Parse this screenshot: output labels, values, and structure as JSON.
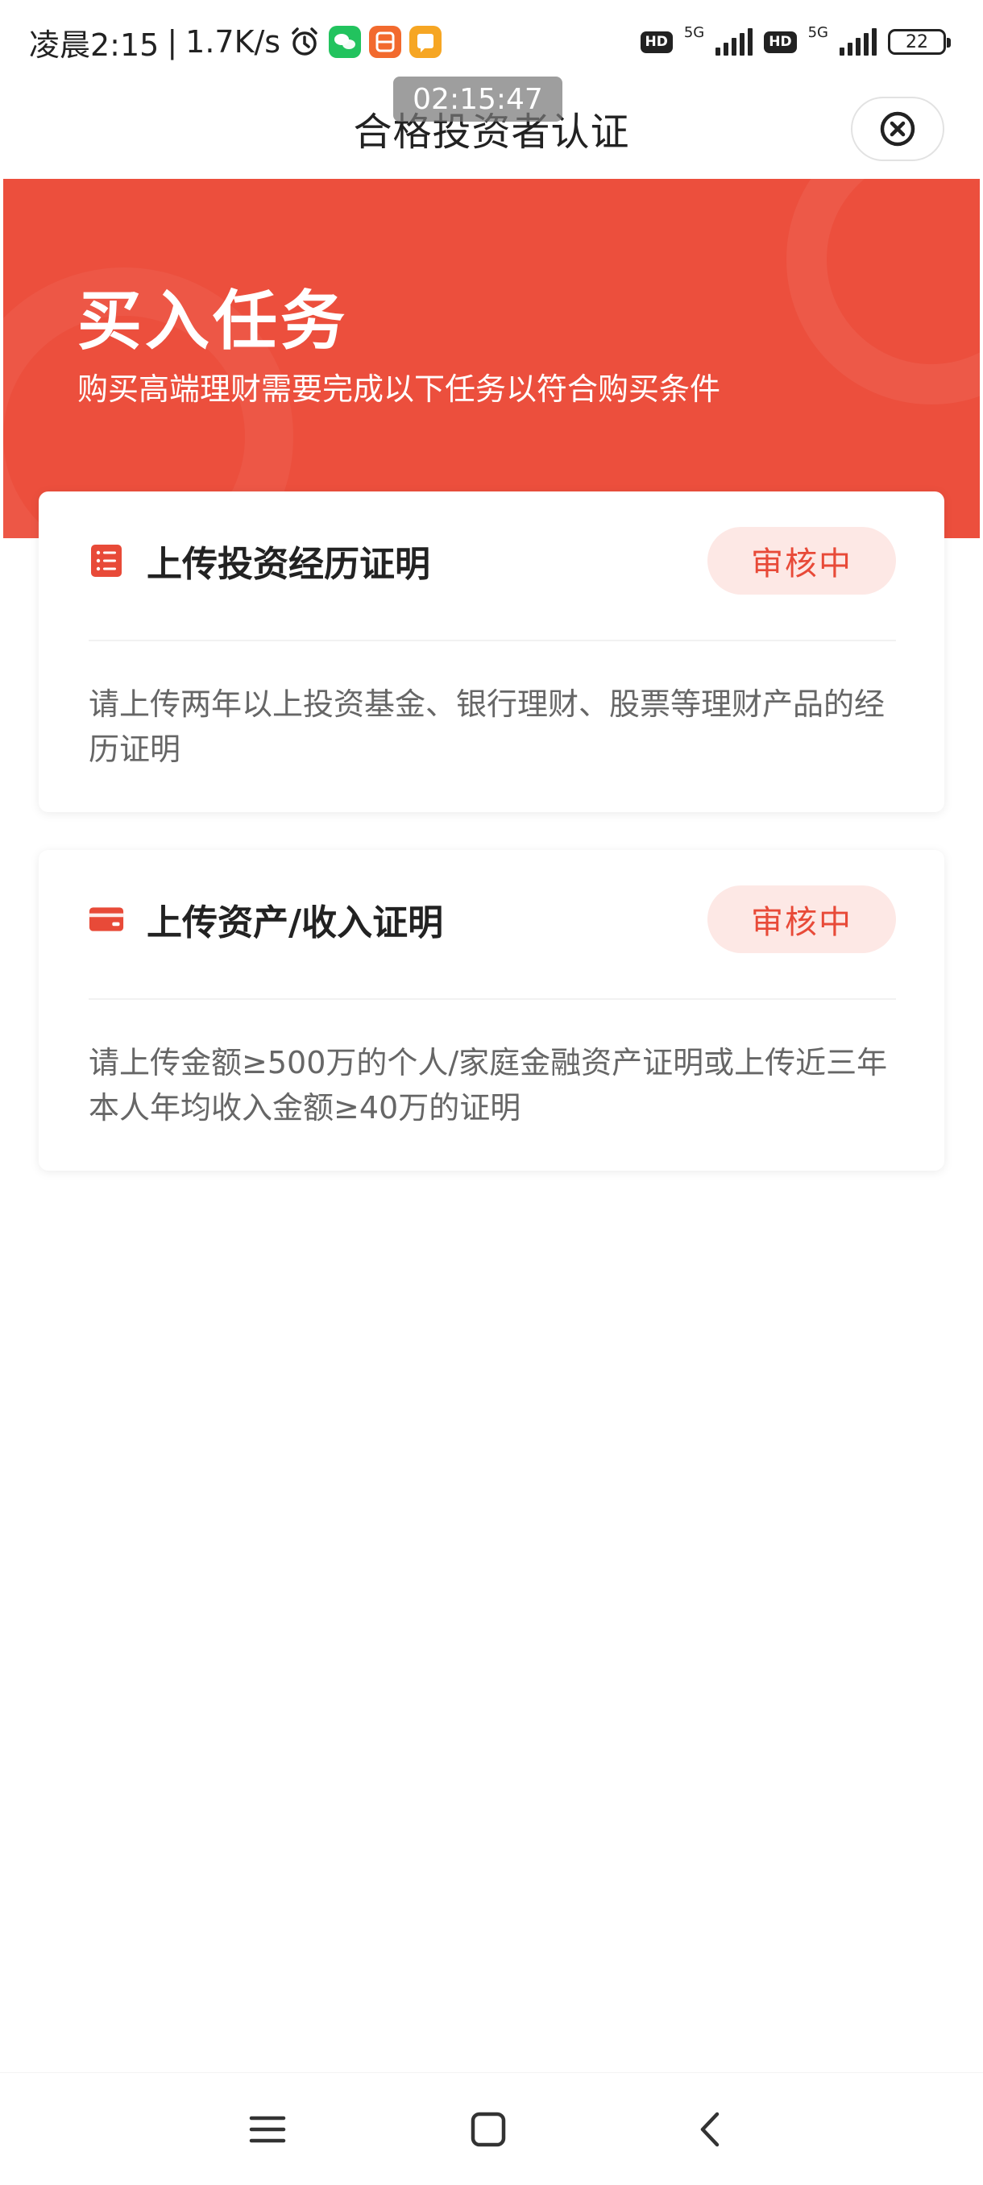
{
  "status_bar": {
    "time": "凌晨2:15",
    "separator": "|",
    "net_speed": "1.7K/s",
    "icons": [
      "alarm-icon",
      "wechat-icon",
      "orange-app-icon",
      "yellow-app-icon",
      "hd-icon",
      "signal-5g-icon",
      "hd-icon",
      "signal-5g-icon",
      "battery-icon"
    ],
    "hd_label": "HD",
    "network_label": "5G",
    "battery_level": "22"
  },
  "overlay": {
    "time": "02:15:47"
  },
  "nav": {
    "title": "合格投资者认证",
    "close_icon": "close-circle-icon"
  },
  "banner": {
    "title": "买入任务",
    "subtitle": "购买高端理财需要完成以下任务以符合购买条件",
    "color": "#ec4f3d"
  },
  "tasks": [
    {
      "icon": "document-list-icon",
      "title": "上传投资经历证明",
      "status": "审核中",
      "description": "请上传两年以上投资基金、银行理财、股票等理财产品的经历证明"
    },
    {
      "icon": "card-icon",
      "title": "上传资产/收入证明",
      "status": "审核中",
      "description": "请上传金额≥500万的个人/家庭金融资产证明或上传近三年本人年均收入金额≥40万的证明"
    }
  ],
  "colors": {
    "accent": "#e84a38",
    "badge_bg": "#fde8e5"
  },
  "bottom_nav": {
    "keys": [
      "menu-icon",
      "home-icon",
      "back-icon"
    ]
  }
}
